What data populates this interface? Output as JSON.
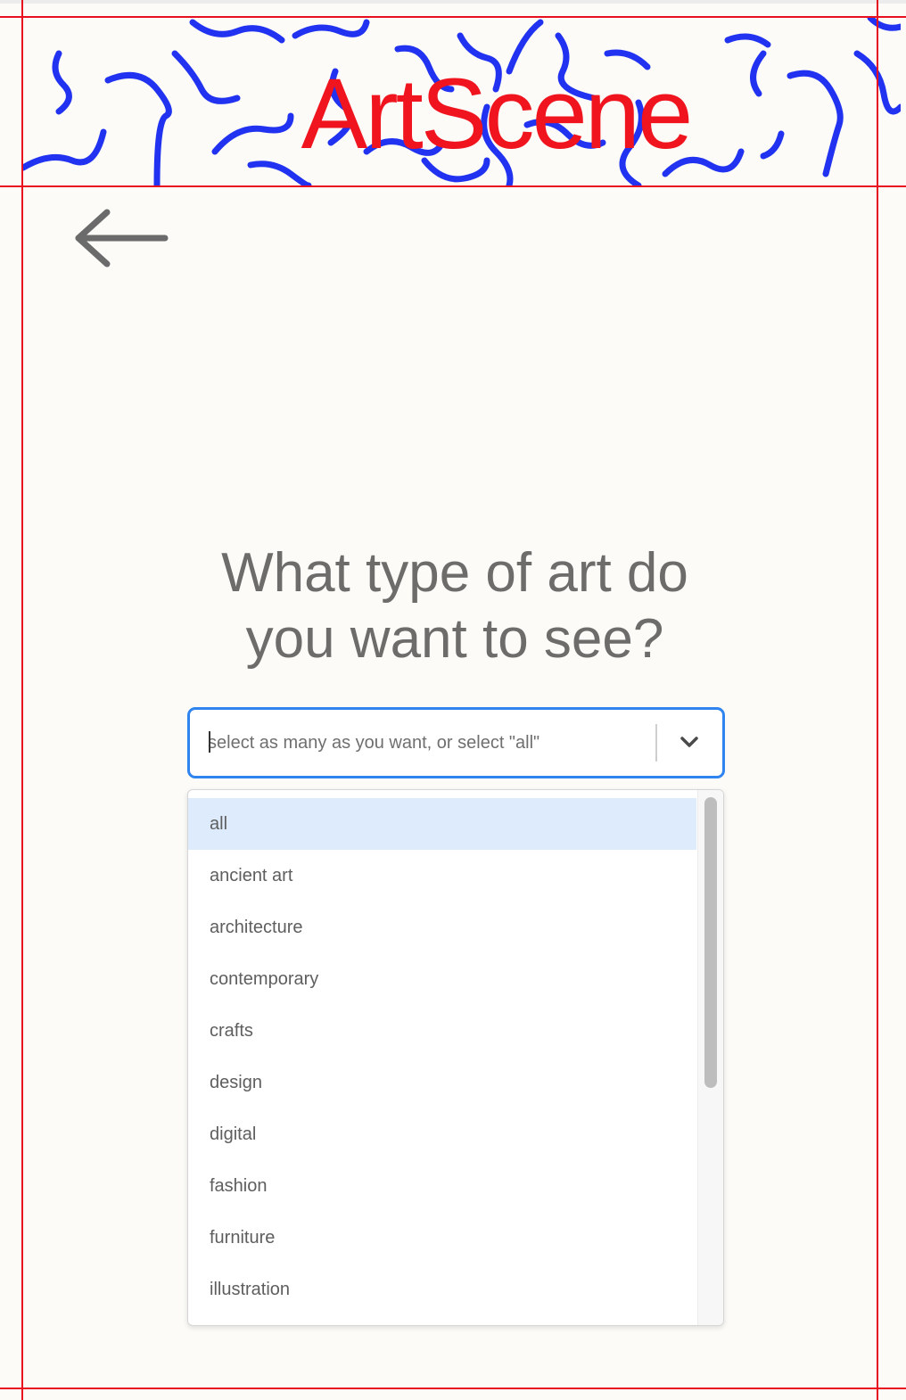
{
  "app": {
    "brand": "ArtScene"
  },
  "navigation": {
    "back_icon": "arrow-left-icon"
  },
  "question": {
    "title": "What type of art do you want to see?"
  },
  "select": {
    "placeholder": "select as many as you want, or select \"all\"",
    "value": "",
    "dropdown_icon": "chevron-down-icon",
    "options": [
      {
        "label": "all",
        "focused": true
      },
      {
        "label": "ancient art",
        "focused": false
      },
      {
        "label": "architecture",
        "focused": false
      },
      {
        "label": "contemporary",
        "focused": false
      },
      {
        "label": "crafts",
        "focused": false
      },
      {
        "label": "design",
        "focused": false
      },
      {
        "label": "digital",
        "focused": false
      },
      {
        "label": "fashion",
        "focused": false
      },
      {
        "label": "furniture",
        "focused": false
      },
      {
        "label": "illustration",
        "focused": false
      }
    ]
  },
  "colors": {
    "brand_red": "#f0141e",
    "squiggle_blue": "#2133f0",
    "focus_blue": "#2f84ef",
    "option_highlight": "#deebfc",
    "text_gray": "#6d6c6a",
    "background": "#fcfbf8"
  }
}
